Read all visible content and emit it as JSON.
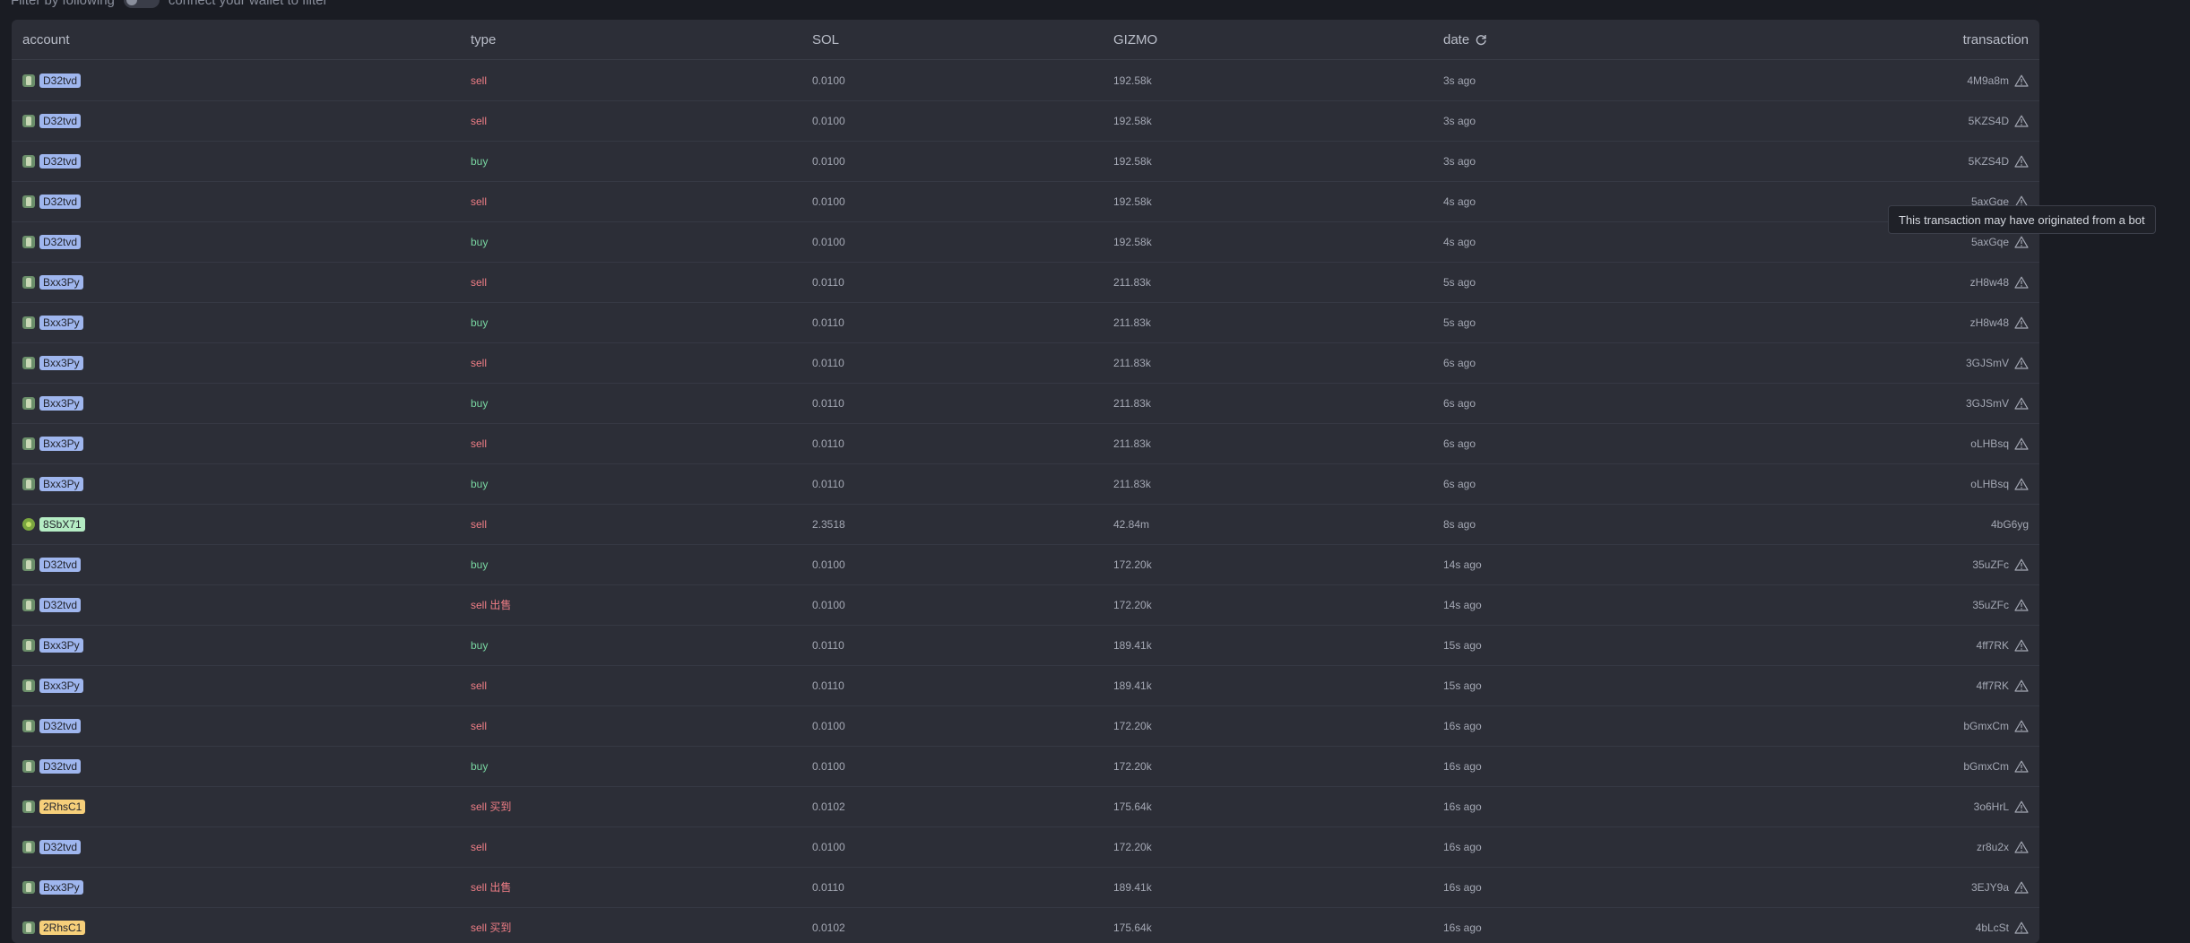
{
  "filter": {
    "label": "Filter by following",
    "hint": "connect your wallet to filter"
  },
  "table": {
    "headers": {
      "account": "account",
      "type": "type",
      "sol": "SOL",
      "gizmo": "GIZMO",
      "date": "date",
      "transaction": "transaction"
    },
    "rows": [
      {
        "account": "D32tvd",
        "badge_color": "#9fb6ee",
        "avatar": "square",
        "type": "sell",
        "sol": "0.0100",
        "gizmo": "192.58k",
        "date": "3s ago",
        "tx": "4M9a8m",
        "bot_warning": true
      },
      {
        "account": "D32tvd",
        "badge_color": "#9fb6ee",
        "avatar": "square",
        "type": "sell",
        "sol": "0.0100",
        "gizmo": "192.58k",
        "date": "3s ago",
        "tx": "5KZS4D",
        "bot_warning": true
      },
      {
        "account": "D32tvd",
        "badge_color": "#9fb6ee",
        "avatar": "square",
        "type": "buy",
        "sol": "0.0100",
        "gizmo": "192.58k",
        "date": "3s ago",
        "tx": "5KZS4D",
        "bot_warning": true
      },
      {
        "account": "D32tvd",
        "badge_color": "#9fb6ee",
        "avatar": "square",
        "type": "sell",
        "sol": "0.0100",
        "gizmo": "192.58k",
        "date": "4s ago",
        "tx": "5axGqe",
        "bot_warning": true
      },
      {
        "account": "D32tvd",
        "badge_color": "#9fb6ee",
        "avatar": "square",
        "type": "buy",
        "sol": "0.0100",
        "gizmo": "192.58k",
        "date": "4s ago",
        "tx": "5axGqe",
        "bot_warning": true
      },
      {
        "account": "Bxx3Py",
        "badge_color": "#9fb6ee",
        "avatar": "square",
        "type": "sell",
        "sol": "0.0110",
        "gizmo": "211.83k",
        "date": "5s ago",
        "tx": "zH8w48",
        "bot_warning": true
      },
      {
        "account": "Bxx3Py",
        "badge_color": "#9fb6ee",
        "avatar": "square",
        "type": "buy",
        "sol": "0.0110",
        "gizmo": "211.83k",
        "date": "5s ago",
        "tx": "zH8w48",
        "bot_warning": true
      },
      {
        "account": "Bxx3Py",
        "badge_color": "#9fb6ee",
        "avatar": "square",
        "type": "sell",
        "sol": "0.0110",
        "gizmo": "211.83k",
        "date": "6s ago",
        "tx": "3GJSmV",
        "bot_warning": true
      },
      {
        "account": "Bxx3Py",
        "badge_color": "#9fb6ee",
        "avatar": "square",
        "type": "buy",
        "sol": "0.0110",
        "gizmo": "211.83k",
        "date": "6s ago",
        "tx": "3GJSmV",
        "bot_warning": true
      },
      {
        "account": "Bxx3Py",
        "badge_color": "#9fb6ee",
        "avatar": "square",
        "type": "sell",
        "sol": "0.0110",
        "gizmo": "211.83k",
        "date": "6s ago",
        "tx": "oLHBsq",
        "bot_warning": true
      },
      {
        "account": "Bxx3Py",
        "badge_color": "#9fb6ee",
        "avatar": "square",
        "type": "buy",
        "sol": "0.0110",
        "gizmo": "211.83k",
        "date": "6s ago",
        "tx": "oLHBsq",
        "bot_warning": true
      },
      {
        "account": "8SbX71",
        "badge_color": "#b5ecc4",
        "avatar": "round",
        "type": "sell",
        "sol": "2.3518",
        "gizmo": "42.84m",
        "date": "8s ago",
        "tx": "4bG6yg",
        "bot_warning": false
      },
      {
        "account": "D32tvd",
        "badge_color": "#9fb6ee",
        "avatar": "square",
        "type": "buy",
        "sol": "0.0100",
        "gizmo": "172.20k",
        "date": "14s ago",
        "tx": "35uZFc",
        "bot_warning": true
      },
      {
        "account": "D32tvd",
        "badge_color": "#9fb6ee",
        "avatar": "square",
        "type": "sell 出售",
        "sol": "0.0100",
        "gizmo": "172.20k",
        "date": "14s ago",
        "tx": "35uZFc",
        "bot_warning": true
      },
      {
        "account": "Bxx3Py",
        "badge_color": "#9fb6ee",
        "avatar": "square",
        "type": "buy",
        "sol": "0.0110",
        "gizmo": "189.41k",
        "date": "15s ago",
        "tx": "4ff7RK",
        "bot_warning": true
      },
      {
        "account": "Bxx3Py",
        "badge_color": "#9fb6ee",
        "avatar": "square",
        "type": "sell",
        "sol": "0.0110",
        "gizmo": "189.41k",
        "date": "15s ago",
        "tx": "4ff7RK",
        "bot_warning": true
      },
      {
        "account": "D32tvd",
        "badge_color": "#9fb6ee",
        "avatar": "square",
        "type": "sell",
        "sol": "0.0100",
        "gizmo": "172.20k",
        "date": "16s ago",
        "tx": "bGmxCm",
        "bot_warning": true
      },
      {
        "account": "D32tvd",
        "badge_color": "#9fb6ee",
        "avatar": "square",
        "type": "buy",
        "sol": "0.0100",
        "gizmo": "172.20k",
        "date": "16s ago",
        "tx": "bGmxCm",
        "bot_warning": true
      },
      {
        "account": "2RhsC1",
        "badge_color": "#f6cf7a",
        "avatar": "square",
        "type": "sell 买到",
        "sol": "0.0102",
        "gizmo": "175.64k",
        "date": "16s ago",
        "tx": "3o6HrL",
        "bot_warning": true
      },
      {
        "account": "D32tvd",
        "badge_color": "#9fb6ee",
        "avatar": "square",
        "type": "sell",
        "sol": "0.0100",
        "gizmo": "172.20k",
        "date": "16s ago",
        "tx": "zr8u2x",
        "bot_warning": true
      },
      {
        "account": "Bxx3Py",
        "badge_color": "#9fb6ee",
        "avatar": "square",
        "type": "sell 出售",
        "sol": "0.0110",
        "gizmo": "189.41k",
        "date": "16s ago",
        "tx": "3EJY9a",
        "bot_warning": true
      },
      {
        "account": "2RhsC1",
        "badge_color": "#f6cf7a",
        "avatar": "square",
        "type": "sell 买到",
        "sol": "0.0102",
        "gizmo": "175.64k",
        "date": "16s ago",
        "tx": "4bLcSt",
        "bot_warning": true
      }
    ]
  },
  "tooltip": {
    "text": "This transaction may have originated from a bot"
  },
  "colors": {
    "sell": "#f07e86",
    "buy": "#78d4a0"
  }
}
